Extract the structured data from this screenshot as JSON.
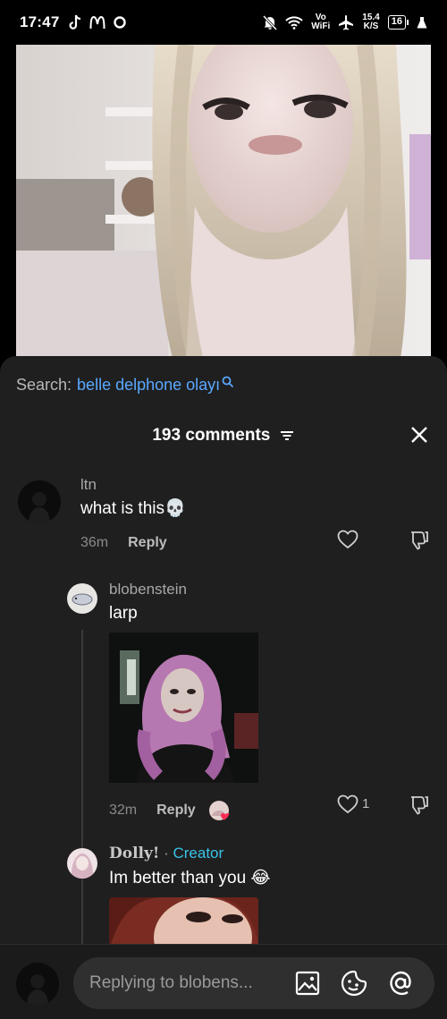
{
  "status_bar": {
    "time": "17:47",
    "left_icons": [
      "tiktok-icon",
      "mcdonalds-icon",
      "sync-icon"
    ],
    "right_icons": [
      "mute-icon",
      "wifi-icon",
      "airplane-icon"
    ],
    "vowifi_top": "Vo",
    "vowifi_bottom": "WiFi",
    "net_speed_value": "15.4",
    "net_speed_unit": "K/S",
    "battery": "16"
  },
  "search": {
    "label": "Search:",
    "query": "belle delphone olayı"
  },
  "comments_header": {
    "count_label": "193 comments"
  },
  "comments": [
    {
      "username": "ltn",
      "text": "what is this💀",
      "time": "36m",
      "reply_label": "Reply"
    }
  ],
  "replies": [
    {
      "username": "blobenstein",
      "text": "larp",
      "time": "32m",
      "reply_label": "Reply",
      "like_count": "1"
    },
    {
      "username": "Dolly!",
      "separator": "·",
      "badge": "Creator",
      "text": "Im better than you 😂"
    }
  ],
  "composer": {
    "placeholder": "Replying to blobens..."
  },
  "colors": {
    "sheet_bg": "#1f1f1f",
    "link_blue": "#5aa8ff",
    "creator_cyan": "#39c4e8"
  }
}
